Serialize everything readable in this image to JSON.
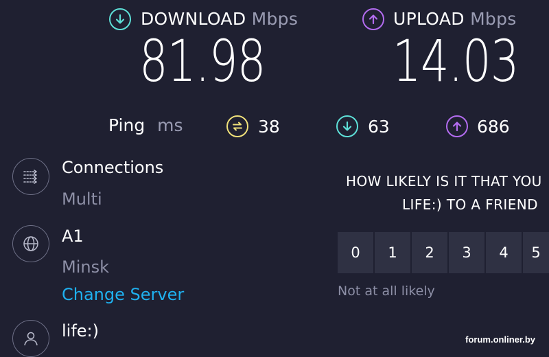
{
  "download": {
    "title": "DOWNLOAD",
    "unit": "Mbps",
    "value": "81.98",
    "icon": "download-icon",
    "color": "#5ee0d8"
  },
  "upload": {
    "title": "UPLOAD",
    "unit": "Mbps",
    "value": "14.03",
    "icon": "upload-icon",
    "color": "#b36cf0"
  },
  "ping": {
    "label": "Ping",
    "unit": "ms",
    "idle": {
      "value": "38",
      "icon": "ping-icon",
      "color": "#efe07a"
    },
    "download": {
      "value": "63",
      "icon": "download-latency-icon",
      "color": "#5ee0d8"
    },
    "upload": {
      "value": "686",
      "icon": "upload-latency-icon",
      "color": "#b36cf0"
    }
  },
  "connections": {
    "title": "Connections",
    "value": "Multi",
    "icon": "connections-icon"
  },
  "server": {
    "name": "A1",
    "location": "Minsk",
    "change_label": "Change Server",
    "icon": "globe-icon"
  },
  "provider": {
    "name": "life:)",
    "icon": "user-icon"
  },
  "survey": {
    "question_line1": "HOW LIKELY IS IT THAT YOU",
    "question_line2": "LIFE:) TO A FRIEND",
    "options": [
      "0",
      "1",
      "2",
      "3",
      "4",
      "5"
    ],
    "low_label": "Not at all likely"
  },
  "watermark": "forum.onliner.by"
}
